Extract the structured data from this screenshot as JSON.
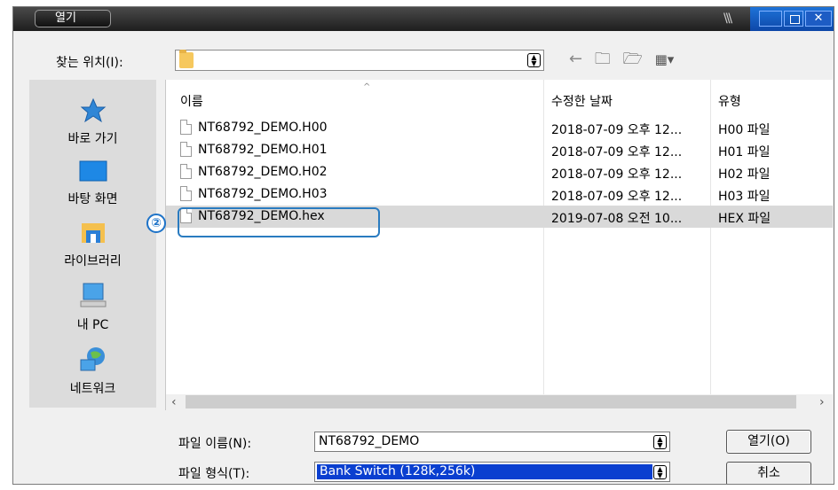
{
  "window": {
    "title": "열기"
  },
  "toolbar": {
    "look_in_label": "찾는 위치(I):",
    "look_in_value": "",
    "icons": [
      "back-arrow-icon",
      "up-folder-icon",
      "new-folder-icon",
      "view-menu-icon"
    ]
  },
  "places": [
    {
      "label": "바로 가기",
      "icon": "star-icon"
    },
    {
      "label": "바탕 화면",
      "icon": "desktop-icon"
    },
    {
      "label": "라이브러리",
      "icon": "library-icon"
    },
    {
      "label": "내 PC",
      "icon": "computer-icon"
    },
    {
      "label": "네트워크",
      "icon": "network-icon"
    }
  ],
  "columns": {
    "name": "이름",
    "date": "수정한 날짜",
    "type": "유형"
  },
  "files": [
    {
      "name": "NT68792_DEMO.H00",
      "date": "2018-07-09 오후 12...",
      "type": "H00 파일",
      "selected": false
    },
    {
      "name": "NT68792_DEMO.H01",
      "date": "2018-07-09 오후 12...",
      "type": "H01 파일",
      "selected": false
    },
    {
      "name": "NT68792_DEMO.H02",
      "date": "2018-07-09 오후 12...",
      "type": "H02 파일",
      "selected": false
    },
    {
      "name": "NT68792_DEMO.H03",
      "date": "2018-07-09 오후 12...",
      "type": "H03 파일",
      "selected": false
    },
    {
      "name": "NT68792_DEMO.hex",
      "date": "2019-07-08 오전 10...",
      "type": "HEX 파일",
      "selected": true
    }
  ],
  "callout": {
    "number": "②"
  },
  "bottom": {
    "filename_label": "파일 이름(N):",
    "filename_value": "NT68792_DEMO",
    "filetype_label": "파일 형식(T):",
    "filetype_value": "Bank Switch (128k,256k)",
    "open_button": "열기(O)",
    "cancel_button": "취소"
  },
  "colors": {
    "accent": "#1e73c8",
    "selection": "#0a3fd0",
    "titlebar": "#2a2a2a"
  }
}
